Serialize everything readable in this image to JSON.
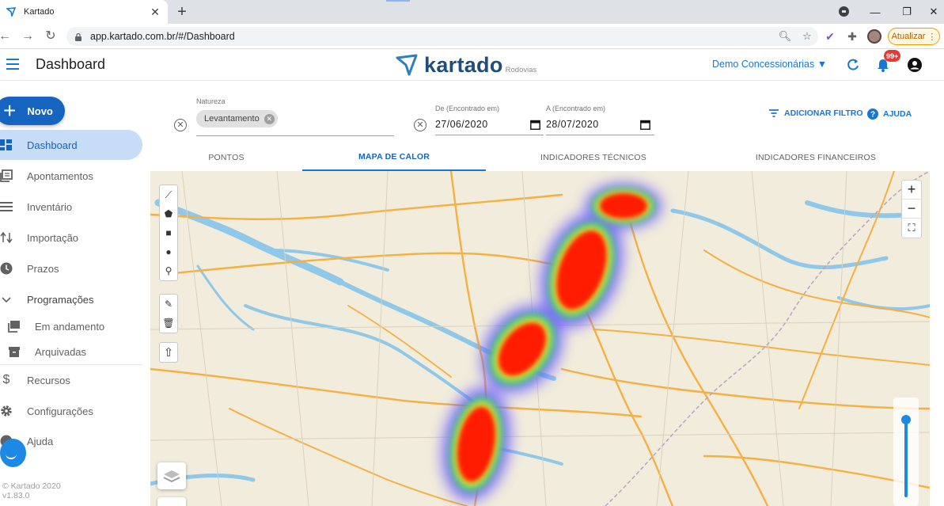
{
  "browser": {
    "tab_title": "Kartado",
    "url": "app.kartado.com.br/#/Dashboard",
    "update_label": "Atualizar"
  },
  "header": {
    "title": "Dashboard",
    "brand_name": "kartado",
    "brand_sub": "Rodovias",
    "tenant": "Demo Concessionárias ▼",
    "notifications_badge": "99+"
  },
  "sidebar": {
    "new_button": "Novo",
    "items": [
      {
        "label": "Dashboard",
        "icon": "dashboard-icon",
        "active": true
      },
      {
        "label": "Apontamentos",
        "icon": "notes-icon"
      },
      {
        "label": "Inventário",
        "icon": "list-icon"
      },
      {
        "label": "Importação",
        "icon": "import-icon"
      },
      {
        "label": "Prazos",
        "icon": "clock-icon"
      },
      {
        "label": "Programações",
        "icon": "chevron-down-icon"
      },
      {
        "label": "Em andamento",
        "icon": "folder-icon"
      },
      {
        "label": "Arquivadas",
        "icon": "archive-icon"
      },
      {
        "label": "Recursos",
        "icon": "dollar-icon"
      },
      {
        "label": "Configurações",
        "icon": "gear-icon"
      },
      {
        "label": "Ajuda",
        "icon": "help-icon"
      }
    ],
    "copyright": "© Kartado 2020",
    "version": "v1.83.0"
  },
  "filters": {
    "natureza_label": "Natureza",
    "natureza_chip": "Levantamento",
    "from_label": "De (Encontrado em)",
    "from_value": "27/06/2020",
    "to_label": "A (Encontrado em)",
    "to_value": "28/07/2020",
    "add_filter": "ADICIONAR FILTRO",
    "help": "AJUDA"
  },
  "tabs": [
    {
      "label": "PONTOS",
      "active": false
    },
    {
      "label": "MAPA DE CALOR",
      "active": true
    },
    {
      "label": "INDICADORES TÉCNICOS",
      "active": false
    },
    {
      "label": "INDICADORES FINANCEIROS",
      "active": false
    }
  ],
  "map": {
    "zoom_in": "+",
    "zoom_out": "−",
    "colors": {
      "water": "#8fc8e8",
      "highway": "#f5b041",
      "land": "#f2ecdc",
      "heat_core": "#ff1a00"
    }
  },
  "colors": {
    "primary": "#1976d2",
    "active_bg": "#c6dcf7",
    "badge": "#e53935"
  }
}
